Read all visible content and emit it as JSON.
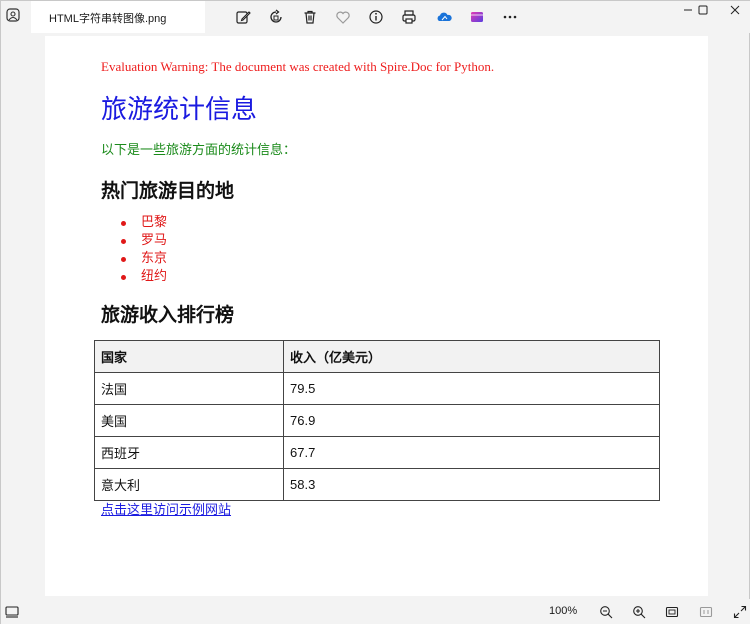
{
  "window": {
    "tab_title": "HTML字符串转图像.png"
  },
  "toolbar": {
    "icons": [
      "edit-icon",
      "rotate-icon",
      "delete-icon",
      "favorite-icon",
      "info-icon",
      "print-icon",
      "onedrive-icon",
      "clipchamp-icon",
      "more-icon"
    ]
  },
  "document": {
    "warning": "Evaluation Warning: The document was created with Spire.Doc for Python.",
    "title": "旅游统计信息",
    "intro": "以下是一些旅游方面的统计信息：",
    "destinations_heading": "热门旅游目的地",
    "destinations": [
      "巴黎",
      "罗马",
      "东京",
      "纽约"
    ],
    "ranking_heading": "旅游收入排行榜",
    "table": {
      "headers": [
        "国家",
        "收入（亿美元）"
      ],
      "rows": [
        [
          "法国",
          "79.5"
        ],
        [
          "美国",
          "76.9"
        ],
        [
          "西班牙",
          "67.7"
        ],
        [
          "意大利",
          "58.3"
        ]
      ]
    },
    "link_text": "点击这里访问示例网站"
  },
  "statusbar": {
    "zoom": "100%"
  },
  "colors": {
    "warning": "#ee1c1c",
    "title": "#1a1ae0",
    "intro": "#1a8a1a",
    "list": "#e01818",
    "link": "#1a1ae0"
  }
}
